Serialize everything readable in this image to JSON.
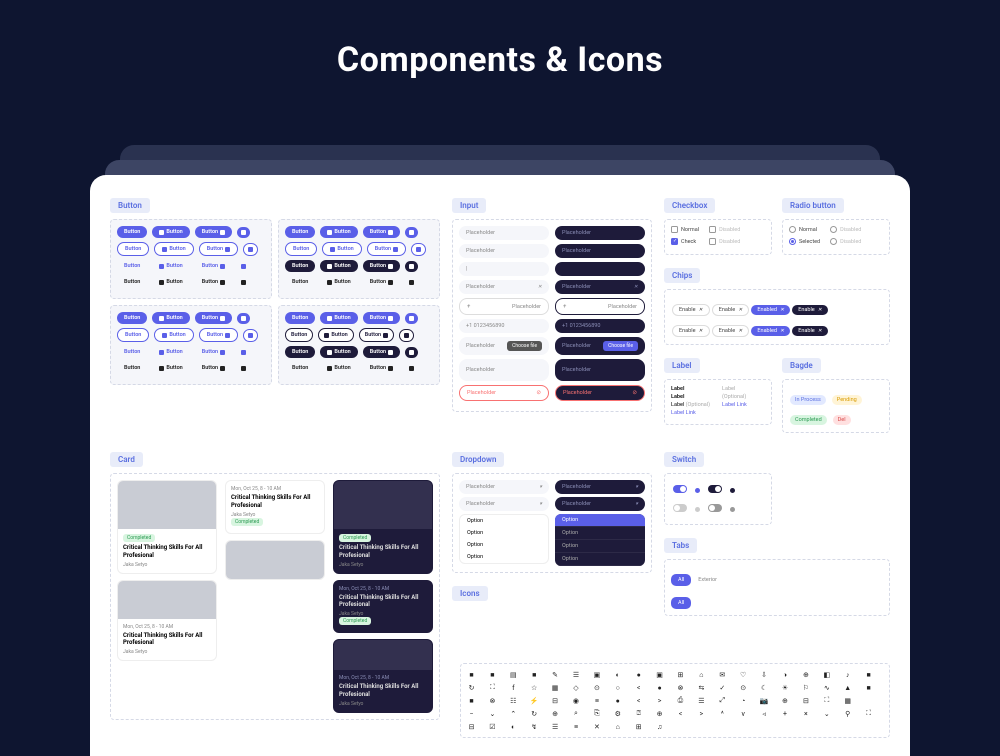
{
  "title": "Components & Icons",
  "sections": {
    "button": "Button",
    "input": "Input",
    "checkbox": "Checkbox",
    "radio": "Radio button",
    "chips": "Chips",
    "label": "Label",
    "badge": "Bagde",
    "card": "Card",
    "dropdown": "Dropdown",
    "switch": "Switch",
    "tabs": "Tabs",
    "icons": "Icons"
  },
  "button_label": "Button",
  "input": {
    "placeholder": "Placeholder",
    "phone": "+1    0123456890",
    "choose_file": "Choose file"
  },
  "checkbox": {
    "normal": "Normal",
    "check": "Check",
    "disabled": "Disabled"
  },
  "radio": {
    "normal": "Normal",
    "selected": "Selected",
    "disabled": "Disabled"
  },
  "chip": {
    "enable": "Enable",
    "enabled": "Enabled"
  },
  "label": {
    "label": "Label",
    "optional": "(Optional)",
    "link": "Label Link"
  },
  "badge": {
    "inprogress": "In Process",
    "pending": "Pending",
    "completed": "Completed",
    "del": "Del"
  },
  "card": {
    "date": "Mon, Oct 25, 8 - 10 AM",
    "title": "Critical Thinking Skills For All Profesional",
    "author": "Jaka Setyo",
    "completed": "Completed"
  },
  "dropdown": {
    "placeholder": "Placeholder",
    "option": "Option"
  },
  "tabs": {
    "all": "All",
    "exterior": "Exterior"
  },
  "icons_set": [
    "■",
    "■",
    "▤",
    "■",
    "✎",
    "☰",
    "▣",
    "◐",
    "●",
    "▣",
    "⊞",
    "⌂",
    "✉",
    "♡",
    "⇩",
    "◑",
    "⊕",
    "◧",
    "♪",
    "■",
    "↻",
    "⛶",
    "f",
    "☆",
    "▦",
    "◇",
    "⊙",
    "○",
    "<",
    "●",
    "⊗",
    "⇆",
    "✓",
    "⊙",
    "☾",
    "☀",
    "⚐",
    "∿",
    "▲",
    "■",
    "■",
    "⊗",
    "☷",
    "⚡",
    "⊟",
    "◉",
    "≡",
    "●",
    "<",
    ">",
    "⎙",
    "☰",
    "⤢",
    "◔",
    "📷",
    "⊕",
    "⊟",
    "⛶",
    "▦",
    "",
    "−",
    "⌄",
    "⌃",
    "↻",
    "⊕",
    "⌕",
    "⎘",
    "⚙",
    "⍰",
    "⊕",
    "<",
    ">",
    "^",
    "v",
    "◃",
    "+",
    "×",
    "⌄",
    "⚲",
    "⛶",
    "⊟",
    "☑",
    "◐",
    "↯",
    "☰",
    "≡",
    "✕",
    "⌂",
    "⊞",
    "♫",
    "",
    "",
    "",
    "",
    "",
    "",
    "",
    "",
    "",
    ""
  ]
}
